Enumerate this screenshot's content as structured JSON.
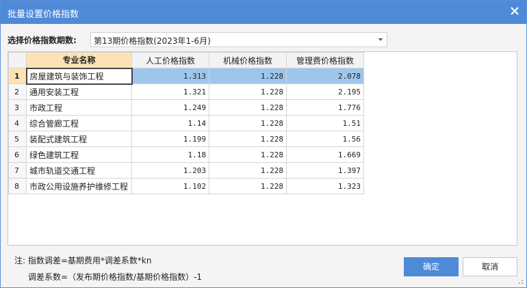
{
  "window": {
    "title": "批量设置价格指数"
  },
  "period": {
    "label": "选择价格指数期数:",
    "value": "第13期价格指数(2023年1-6月)"
  },
  "table": {
    "headers": [
      "专业名称",
      "人工价格指数",
      "机械价格指数",
      "管理费价格指数"
    ],
    "rows": [
      {
        "num": "1",
        "name": "房屋建筑与装饰工程",
        "labor": "1.313",
        "machine": "1.228",
        "mgmt": "2.078"
      },
      {
        "num": "2",
        "name": "通用安装工程",
        "labor": "1.321",
        "machine": "1.228",
        "mgmt": "2.195"
      },
      {
        "num": "3",
        "name": "市政工程",
        "labor": "1.249",
        "machine": "1.228",
        "mgmt": "1.776"
      },
      {
        "num": "4",
        "name": "综合管廊工程",
        "labor": "1.14",
        "machine": "1.228",
        "mgmt": "1.51"
      },
      {
        "num": "5",
        "name": "装配式建筑工程",
        "labor": "1.199",
        "machine": "1.228",
        "mgmt": "1.56"
      },
      {
        "num": "6",
        "name": "绿色建筑工程",
        "labor": "1.18",
        "machine": "1.228",
        "mgmt": "1.669"
      },
      {
        "num": "7",
        "name": "城市轨道交通工程",
        "labor": "1.203",
        "machine": "1.228",
        "mgmt": "1.397"
      },
      {
        "num": "8",
        "name": "市政公用设施养护维修工程",
        "labor": "1.102",
        "machine": "1.228",
        "mgmt": "1.323"
      }
    ]
  },
  "notes": {
    "line1": "注: 指数调差=基期费用*调差系数*kn",
    "line2": "调差系数=（发布期价格指数/基期价格指数）-1"
  },
  "buttons": {
    "ok": "确定",
    "cancel": "取消"
  },
  "colors": {
    "titlebar": "#4f8ad9",
    "selected_row": "#9ec6ec",
    "active_header": "#fde3b3"
  }
}
